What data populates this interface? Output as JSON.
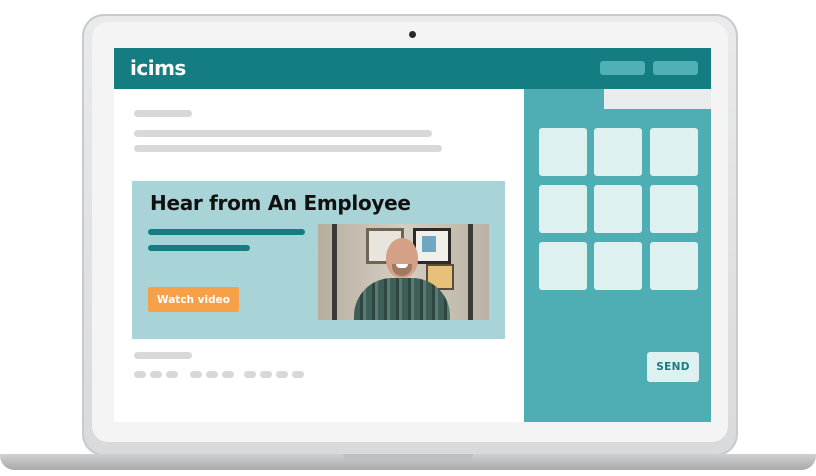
{
  "brand": {
    "logo_text": "icims"
  },
  "feature": {
    "title": "Hear from An Employee",
    "watch_label": "Watch video"
  },
  "panel": {
    "send_label": "SEND"
  },
  "colors": {
    "brand_teal": "#137d82",
    "panel_teal": "#4eaeb4",
    "feature_bg": "#a8d4d8",
    "accent_orange": "#f6a04a",
    "tile_bg": "#dff0f1"
  }
}
